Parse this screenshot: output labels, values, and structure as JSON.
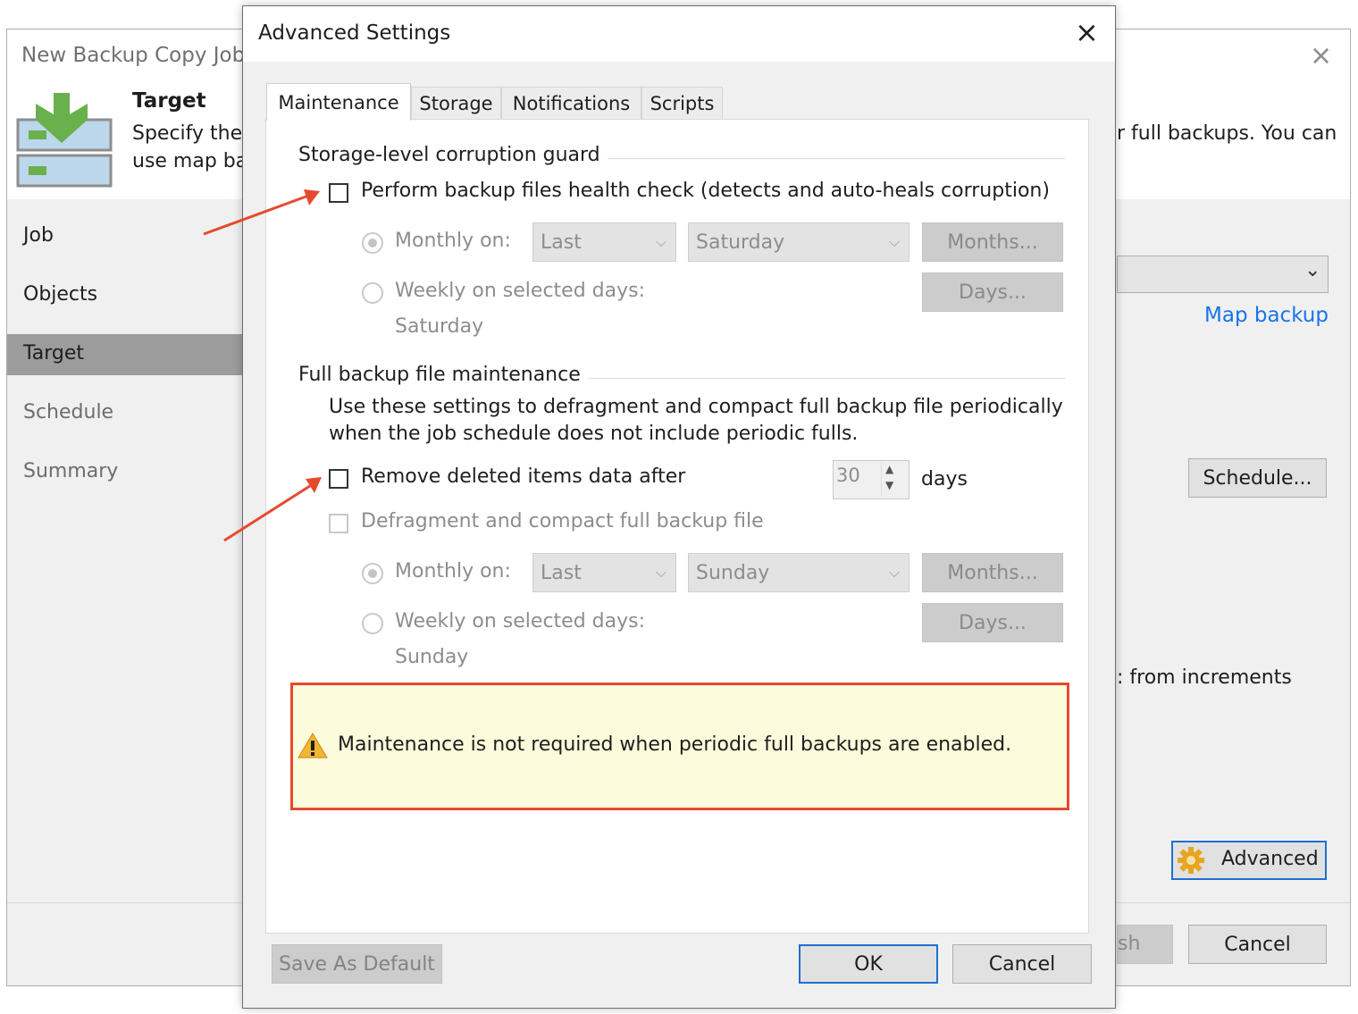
{
  "wizard": {
    "title": "New Backup Copy Job",
    "close_glyph": "×",
    "step_heading": "Target",
    "description_line1": "Specify the t",
    "description_line2": "use map ba",
    "description_right": "r full backups. You can",
    "nav": [
      {
        "label": "Job",
        "state": "normal"
      },
      {
        "label": "Objects",
        "state": "normal"
      },
      {
        "label": "Target",
        "state": "selected"
      },
      {
        "label": "Schedule",
        "state": "dim"
      },
      {
        "label": "Summary",
        "state": "dim"
      }
    ],
    "map_backup_link": "Map backup",
    "schedule_button": "Schedule...",
    "from_increments_text": ": from increments",
    "advanced_button": "Advanced",
    "finish_button": "sh",
    "cancel_button": "Cancel"
  },
  "dialog": {
    "title": "Advanced Settings",
    "close_glyph": "×",
    "tabs": [
      "Maintenance",
      "Storage",
      "Notifications",
      "Scripts"
    ],
    "active_tab": "Maintenance",
    "corruption_guard": {
      "group_label": "Storage-level corruption guard",
      "health_check_label": "Perform backup files health check (detects and auto-heals corruption)",
      "health_check_checked": false,
      "monthly_label": "Monthly on:",
      "monthly_when": "Last",
      "monthly_day": "Saturday",
      "months_button": "Months...",
      "weekly_label": "Weekly on selected days:",
      "days_button": "Days...",
      "weekly_days_value": "Saturday"
    },
    "full_maintenance": {
      "group_label": "Full backup file maintenance",
      "description_line1": "Use these settings to defragment and compact full backup file periodically",
      "description_line2": "when the job schedule does not include periodic fulls.",
      "remove_deleted_label": "Remove deleted items data after",
      "remove_deleted_checked": false,
      "remove_days_value": "30",
      "days_unit": "days",
      "defragment_label": "Defragment and compact full backup file",
      "defragment_checked": false,
      "monthly_label": "Monthly on:",
      "monthly_when": "Last",
      "monthly_day": "Sunday",
      "months_button": "Months...",
      "weekly_label": "Weekly on selected days:",
      "days_button": "Days...",
      "weekly_days_value": "Sunday"
    },
    "warning_text": "Maintenance is not required when periodic full backups are enabled.",
    "save_default_button": "Save As Default",
    "ok_button": "OK",
    "cancel_button": "Cancel"
  },
  "colors": {
    "highlight_border": "#e64a2e",
    "arrow": "#e64a2e",
    "link": "#1a73e8",
    "primary_button_border": "#1f6fd1",
    "warning_bg": "#fcfbdb"
  }
}
